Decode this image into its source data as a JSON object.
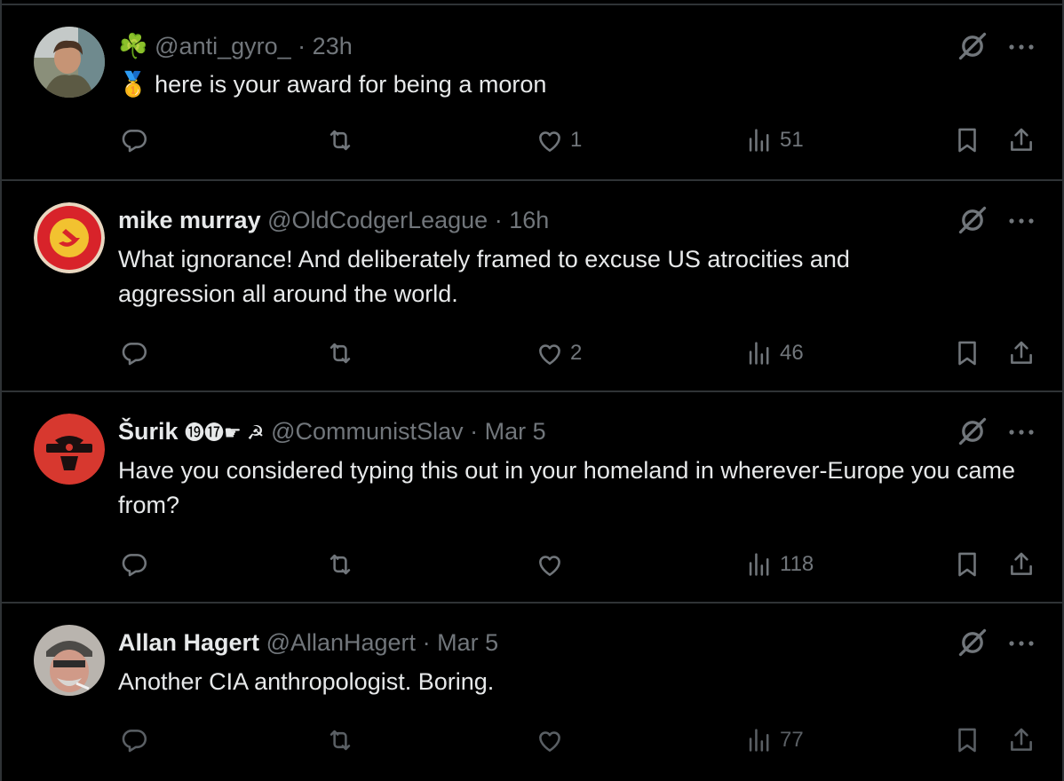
{
  "tweets": [
    {
      "display_name": "",
      "name_emoji": "☘️",
      "handle": "@anti_gyro_",
      "sep": "·",
      "time": "23h",
      "text_emoji": "🥇",
      "text": "here is your award for being a moron",
      "likes": "1",
      "views": "51"
    },
    {
      "display_name": "mike murray",
      "handle": "@OldCodgerLeague",
      "sep": "·",
      "time": "16h",
      "text": "What ignorance! And deliberately framed to excuse US atrocities and aggression all around the world.",
      "likes": "2",
      "views": "46"
    },
    {
      "display_name": "Šurik",
      "name_emoji": "⓳⓱☛ ☭",
      "handle": "@CommunistSlav",
      "sep": "·",
      "time": "Mar 5",
      "text": "Have you considered typing this out in your homeland in wherever-Europe you came from?",
      "likes": "",
      "views": "118"
    },
    {
      "display_name": "Allan Hagert",
      "handle": "@AllanHagert",
      "sep": "·",
      "time": "Mar 5",
      "text": "Another CIA anthropologist. Boring.",
      "likes": "",
      "views": "77"
    }
  ],
  "colors": {
    "background": "#000000",
    "text": "#e7e9ea",
    "muted": "#71767b",
    "divider": "#2f3336"
  },
  "icons": [
    "reply-icon",
    "repost-icon",
    "like-icon",
    "views-icon",
    "bookmark-icon",
    "share-icon",
    "grok-icon",
    "more-icon"
  ]
}
